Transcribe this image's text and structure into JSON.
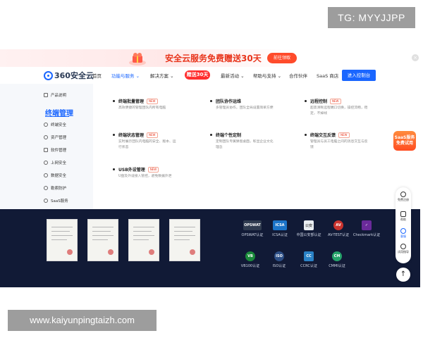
{
  "watermark_top": "TG: MYYJJPP",
  "watermark_bottom": "www.kaiyunpingtaizh.com",
  "banner": {
    "text": "安全云服务免费赠送30天",
    "button": "前往领取",
    "close": "×"
  },
  "nav": {
    "logo_text": "360安全云",
    "items": [
      "首页",
      "功能与服务",
      "解决方案",
      "最新活动",
      "帮助与支持",
      "合作伙伴",
      "SaaS 商店"
    ],
    "hot_label": "赠送30天",
    "cta": "进入控制台",
    "caret": "⌄"
  },
  "menu": {
    "side": {
      "product_intro": "产品说明",
      "title": "终端管理",
      "items": [
        "终端安全",
        "资产管理",
        "软件管理",
        "上网安全",
        "数据安全",
        "勒索防护",
        "SaaS服务"
      ]
    },
    "features": [
      {
        "title": "终端批量管理",
        "tag": "NEW",
        "desc": "高效便捷的管理团队内所有电脑"
      },
      {
        "title": "团队协作运维",
        "tag": "",
        "desc": "多管理员协作，团队全局设置简单方便"
      },
      {
        "title": "远程控制",
        "tag": "NEW",
        "desc": "超高清晰远程端口切换，操控流畅，稳定，不掉线"
      },
      {
        "title": "终端状态管理",
        "tag": "NEW",
        "desc": "实时展示团队内电脑的安全、版本、运行状态"
      },
      {
        "title": "终端个性定制",
        "tag": "",
        "desc": "定制团队专属弹窗桌面，彰显企业文化理念"
      },
      {
        "title": "终端交互反馈",
        "tag": "NEW",
        "desc": "管理员与员工电脑之间的消息交互与反馈"
      },
      {
        "title": "USB外设管理",
        "tag": "NEW",
        "desc": "U盘及外设接入管控，避免数据外泄"
      }
    ]
  },
  "badges": [
    {
      "label": "OPSWAT认证",
      "icon": "OPSWAT",
      "color": "#2f3b4f"
    },
    {
      "label": "ICSA认证",
      "icon": "ICSA",
      "color": "#1c74c9"
    },
    {
      "label": "中国公安部认证",
      "icon": "公安",
      "color": "#e9edf2"
    },
    {
      "label": "AV-TEST认证",
      "icon": "AV",
      "color": "#c9332e"
    },
    {
      "label": "Checkmark认证",
      "icon": "✓",
      "color": "#6a2a9a"
    },
    {
      "label": "VB100认证",
      "icon": "VB",
      "color": "#1a8a3a"
    },
    {
      "label": "ISO认证",
      "icon": "ISO",
      "color": "#2d4f86"
    },
    {
      "label": "CCRC认证",
      "icon": "CC",
      "color": "#2a82c6"
    },
    {
      "label": "CMMI认证",
      "icon": "CM",
      "color": "#25a26a"
    }
  ],
  "floating": {
    "saas_line1": "SaaS服务",
    "saas_line2": "免费试用",
    "toolbar": [
      "免费注册",
      "帮助",
      "客服",
      "试用指导"
    ],
    "to_top": "↑"
  }
}
